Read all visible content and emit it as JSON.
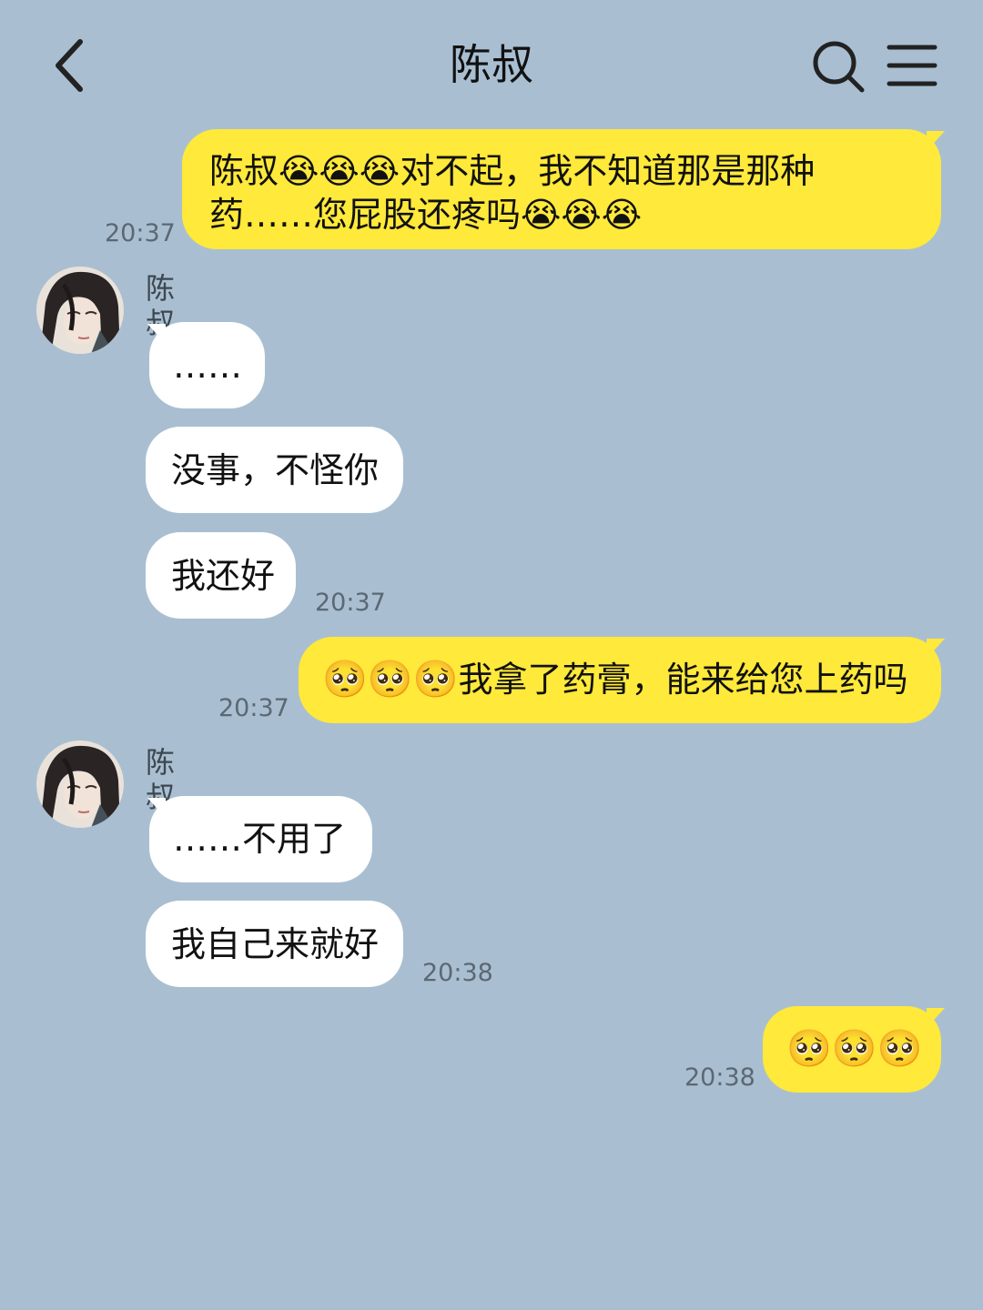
{
  "header": {
    "title": "陈叔",
    "back_icon": "chevron-left-icon",
    "search_icon": "search-icon",
    "menu_icon": "menu-icon"
  },
  "colors": {
    "background": "#a9bfd1",
    "my_bubble": "#ffe93a",
    "their_bubble": "#ffffff"
  },
  "messages": [
    {
      "sender": "me",
      "line1": "陈叔😭😭😭对不起，我不知道那是那种",
      "line2": "药……您屁股还疼吗😭😭😭",
      "time": "20:37"
    },
    {
      "sender": "them",
      "name": "陈叔",
      "bubbles": [
        "……",
        "没事，不怪你",
        "我还好"
      ],
      "time": "20:37"
    },
    {
      "sender": "me",
      "text": "🥺🙏🥺🙏🥺🙏我拿了药膏，能来给您上药吗",
      "emoji_text": "🙏🙏🙏",
      "body_text": "我拿了药膏，能来给您上药吗",
      "time": "20:37"
    },
    {
      "sender": "them",
      "name": "陈叔",
      "bubbles": [
        "……不用了",
        "我自己来就好"
      ],
      "time": "20:38"
    },
    {
      "sender": "me",
      "emoji_text": "🙏🙏🙏",
      "time": "20:38"
    }
  ]
}
